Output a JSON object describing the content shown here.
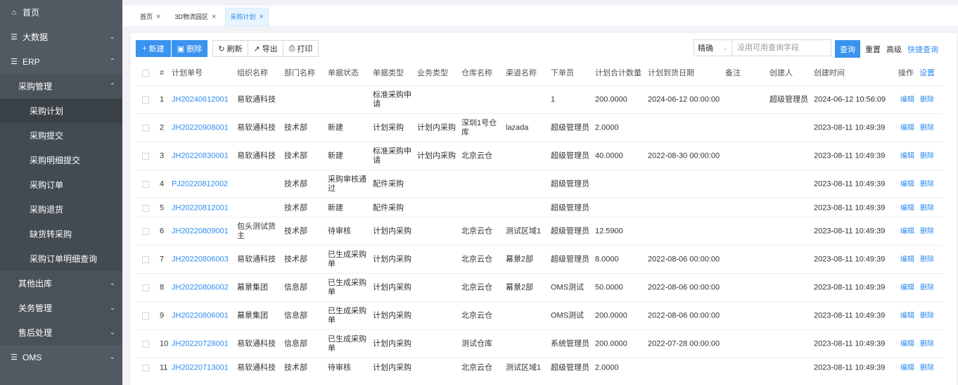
{
  "sidebar": {
    "home": "首页",
    "bigdata": "大数据",
    "erp": "ERP",
    "purchase_mgmt": "采购管理",
    "purchase_plan": "采购计划",
    "purchase_submit": "采购提交",
    "purchase_detail_submit": "采购明细提交",
    "purchase_order": "采购订单",
    "purchase_return": "采购退货",
    "shortage_purchase": "缺货转采购",
    "purchase_order_detail_query": "采购订单明细查询",
    "other_outbound": "其他出库",
    "customs_mgmt": "关务管理",
    "after_sales": "售后处理",
    "oms": "OMS"
  },
  "tabs": [
    {
      "label": "首页"
    },
    {
      "label": "3D物流园区"
    },
    {
      "label": "采购计划"
    }
  ],
  "toolbar": {
    "new": "新建",
    "delete": "删除",
    "refresh": "刷新",
    "export": "导出",
    "print": "打印",
    "search_mode": "精确",
    "search_placeholder": "没用可用查询字段",
    "query": "查询",
    "reset": "重置",
    "advanced": "高级",
    "quick_query": "快捷查询"
  },
  "table": {
    "headers": {
      "index": "#",
      "plan_no": "计划单号",
      "org": "组织名称",
      "dept": "部门名称",
      "status": "单据状态",
      "doc_type": "单据类型",
      "biz_type": "业务类型",
      "warehouse": "仓库名称",
      "channel": "渠道名称",
      "orderer": "下单员",
      "qty": "计划合计数量",
      "arrival": "计划到货日期",
      "remark": "备注",
      "creator": "创建人",
      "created": "创建时间",
      "ops": "操作",
      "settings": "设置"
    },
    "edit_label": "编辑",
    "delete_label": "删除",
    "rows": [
      {
        "index": "1",
        "plan_no": "JH20240612001",
        "org": "易软通科技",
        "dept": "",
        "status": "",
        "doc_type": "标准采购申请",
        "biz_type": "",
        "warehouse": "",
        "channel": "",
        "orderer": "1",
        "qty": "200.0000",
        "arrival": "2024-06-12 00:00:00",
        "remark": "",
        "creator": "超级管理员",
        "created": "2024-06-12 10:56:09"
      },
      {
        "index": "2",
        "plan_no": "JH20220908001",
        "org": "易软通科技",
        "dept": "技术部",
        "status": "新建",
        "doc_type": "计划采购",
        "biz_type": "计划内采购",
        "warehouse": "深圳1号仓库",
        "channel": "lazada",
        "orderer": "超级管理员",
        "qty": "2.0000",
        "arrival": "",
        "remark": "",
        "creator": "",
        "created": "2023-08-11 10:49:39"
      },
      {
        "index": "3",
        "plan_no": "JH20220830001",
        "org": "易软通科技",
        "dept": "技术部",
        "status": "新建",
        "doc_type": "标准采购申请",
        "biz_type": "计划内采购",
        "warehouse": "北京云仓",
        "channel": "",
        "orderer": "超级管理员",
        "qty": "40.0000",
        "arrival": "2022-08-30 00:00:00",
        "remark": "",
        "creator": "",
        "created": "2023-08-11 10:49:39"
      },
      {
        "index": "4",
        "plan_no": "PJ20220812002",
        "org": "",
        "dept": "技术部",
        "status": "采购审核通过",
        "doc_type": "配件采购",
        "biz_type": "",
        "warehouse": "",
        "channel": "",
        "orderer": "超级管理员",
        "qty": "",
        "arrival": "",
        "remark": "",
        "creator": "",
        "created": "2023-08-11 10:49:39"
      },
      {
        "index": "5",
        "plan_no": "JH20220812001",
        "org": "",
        "dept": "技术部",
        "status": "新建",
        "doc_type": "配件采购",
        "biz_type": "",
        "warehouse": "",
        "channel": "",
        "orderer": "超级管理员",
        "qty": "",
        "arrival": "",
        "remark": "",
        "creator": "",
        "created": "2023-08-11 10:49:39"
      },
      {
        "index": "6",
        "plan_no": "JH20220809001",
        "org": "包头测试货主",
        "dept": "技术部",
        "status": "待审核",
        "doc_type": "计划内采购",
        "biz_type": "",
        "warehouse": "北京云仓",
        "channel": "测试区域1",
        "orderer": "超级管理员",
        "qty": "12.5900",
        "arrival": "",
        "remark": "",
        "creator": "",
        "created": "2023-08-11 10:49:39"
      },
      {
        "index": "7",
        "plan_no": "JH20220806003",
        "org": "易软通科技",
        "dept": "技术部",
        "status": "已生成采购单",
        "doc_type": "计划内采购",
        "biz_type": "",
        "warehouse": "北京云仓",
        "channel": "幕景2部",
        "orderer": "超级管理员",
        "qty": "8.0000",
        "arrival": "2022-08-06 00:00:00",
        "remark": "",
        "creator": "",
        "created": "2023-08-11 10:49:39"
      },
      {
        "index": "8",
        "plan_no": "JH20220806002",
        "org": "幕景集团",
        "dept": "信息部",
        "status": "已生成采购单",
        "doc_type": "计划内采购",
        "biz_type": "",
        "warehouse": "北京云仓",
        "channel": "幕景2部",
        "orderer": "OMS测试",
        "qty": "50.0000",
        "arrival": "2022-08-06 00:00:00",
        "remark": "",
        "creator": "",
        "created": "2023-08-11 10:49:39"
      },
      {
        "index": "9",
        "plan_no": "JH20220806001",
        "org": "幕景集团",
        "dept": "信息部",
        "status": "已生成采购单",
        "doc_type": "计划内采购",
        "biz_type": "",
        "warehouse": "北京云仓",
        "channel": "",
        "orderer": "OMS测试",
        "qty": "200.0000",
        "arrival": "2022-08-06 00:00:00",
        "remark": "",
        "creator": "",
        "created": "2023-08-11 10:49:39"
      },
      {
        "index": "10",
        "plan_no": "JH20220728001",
        "org": "易软通科技",
        "dept": "信息部",
        "status": "已生成采购单",
        "doc_type": "计划内采购",
        "biz_type": "",
        "warehouse": "测试仓库",
        "channel": "",
        "orderer": "系统管理员",
        "qty": "200.0000",
        "arrival": "2022-07-28 00:00:00",
        "remark": "",
        "creator": "",
        "created": "2023-08-11 10:49:39"
      },
      {
        "index": "11",
        "plan_no": "JH20220713001",
        "org": "易软通科技",
        "dept": "技术部",
        "status": "待审核",
        "doc_type": "计划内采购",
        "biz_type": "",
        "warehouse": "北京云仓",
        "channel": "测试区域1",
        "orderer": "超级管理员",
        "qty": "2.0000",
        "arrival": "",
        "remark": "",
        "creator": "",
        "created": "2023-08-11 10:49:39"
      }
    ]
  }
}
